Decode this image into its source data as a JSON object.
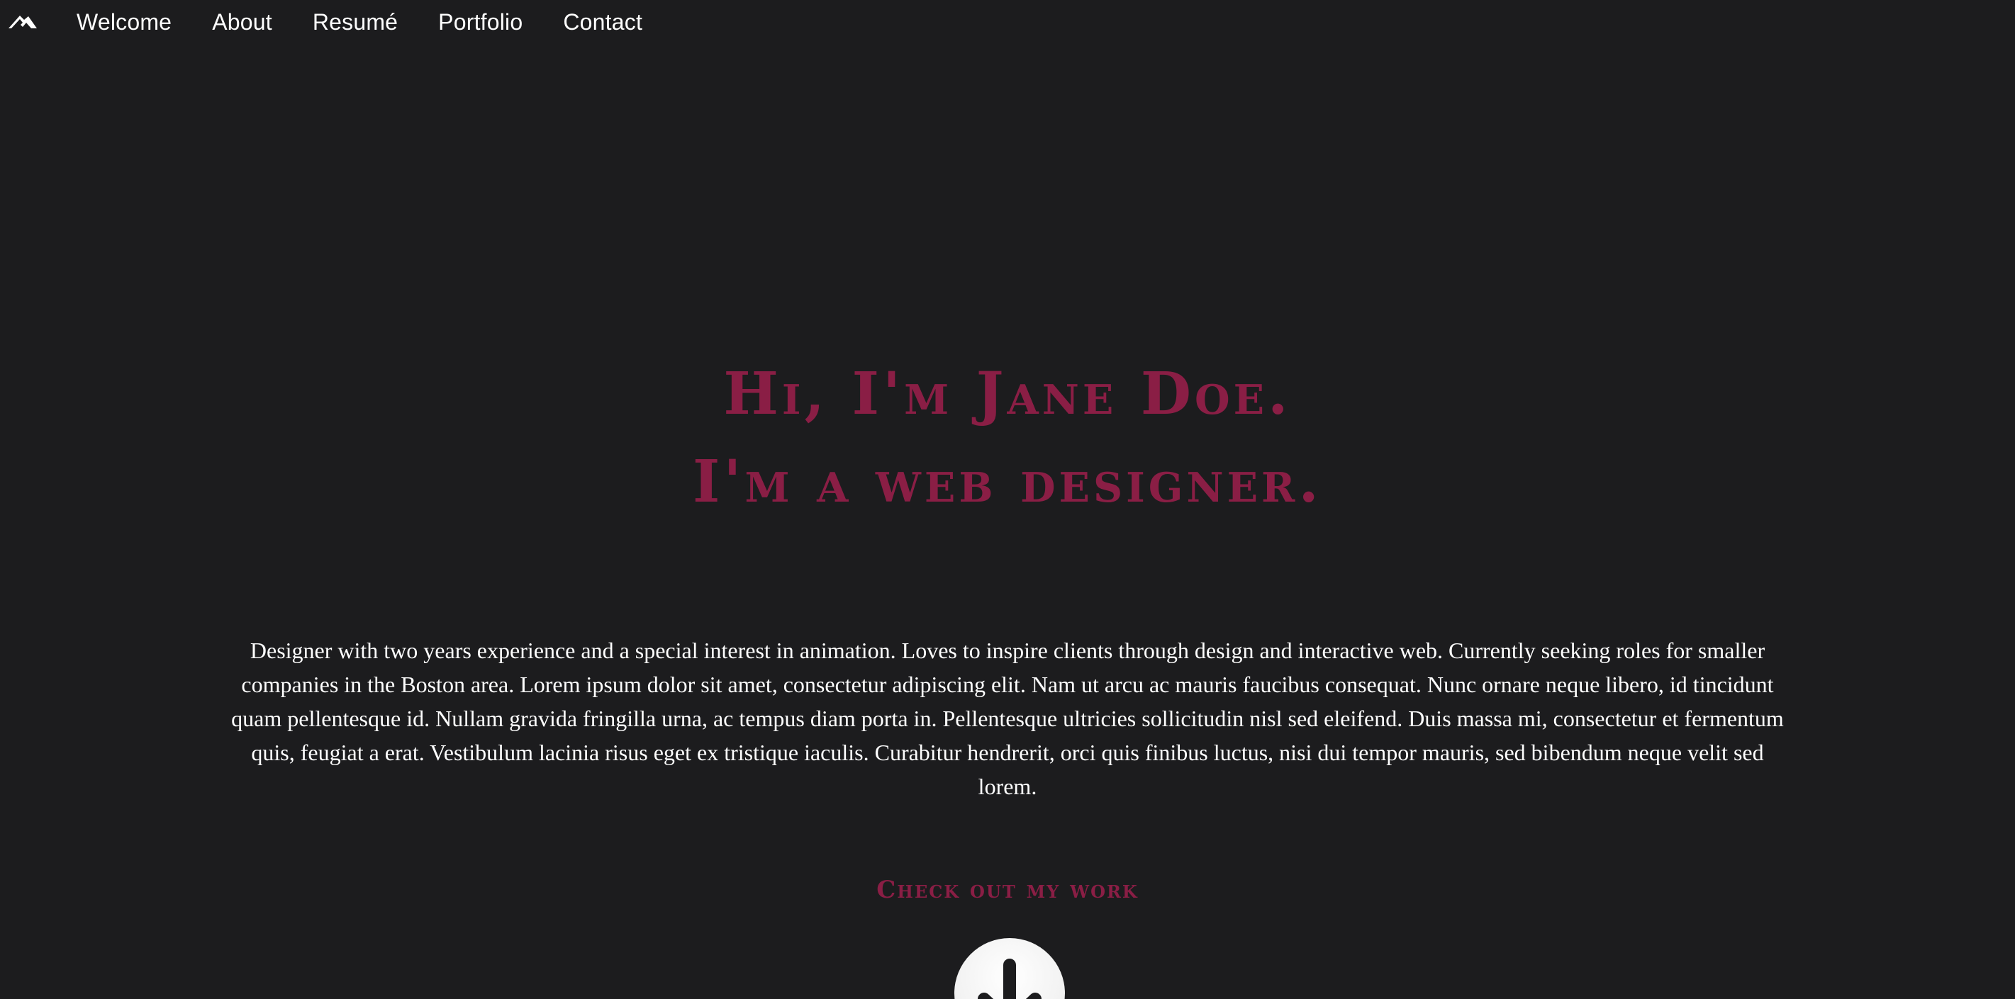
{
  "nav": {
    "logo_icon": "mountain-logo-icon",
    "items": [
      {
        "label": "Welcome"
      },
      {
        "label": "About"
      },
      {
        "label": "Resumé"
      },
      {
        "label": "Portfolio"
      },
      {
        "label": "Contact"
      }
    ]
  },
  "hero": {
    "line1": "Hi, I'm Jane Doe.",
    "line2": "I'm a web designer.",
    "accent_color": "#8a1e45"
  },
  "intro": {
    "text": "Designer with two years experience and a special interest in animation. Loves to inspire clients through design and interactive web. Currently seeking roles for smaller companies in the Boston area. Lorem ipsum dolor sit amet, consectetur adipiscing elit. Nam ut arcu ac mauris faucibus consequat. Nunc ornare neque libero, id tincidunt quam pellentesque id. Nullam gravida fringilla urna, ac tempus diam porta in. Pellentesque ultricies sollicitudin nisl sed eleifend. Duis massa mi, consectetur et fermentum quis, feugiat a erat. Vestibulum lacinia risus eget ex tristique iaculis. Curabitur hendrerit, orci quis finibus luctus, nisi dui tempor mauris, sed bibendum neque velit sed lorem."
  },
  "cta": {
    "label": "Check out my work",
    "button_icon": "arrow-down-icon"
  },
  "theme": {
    "background": "#1c1c1e",
    "text": "#ffffff"
  }
}
